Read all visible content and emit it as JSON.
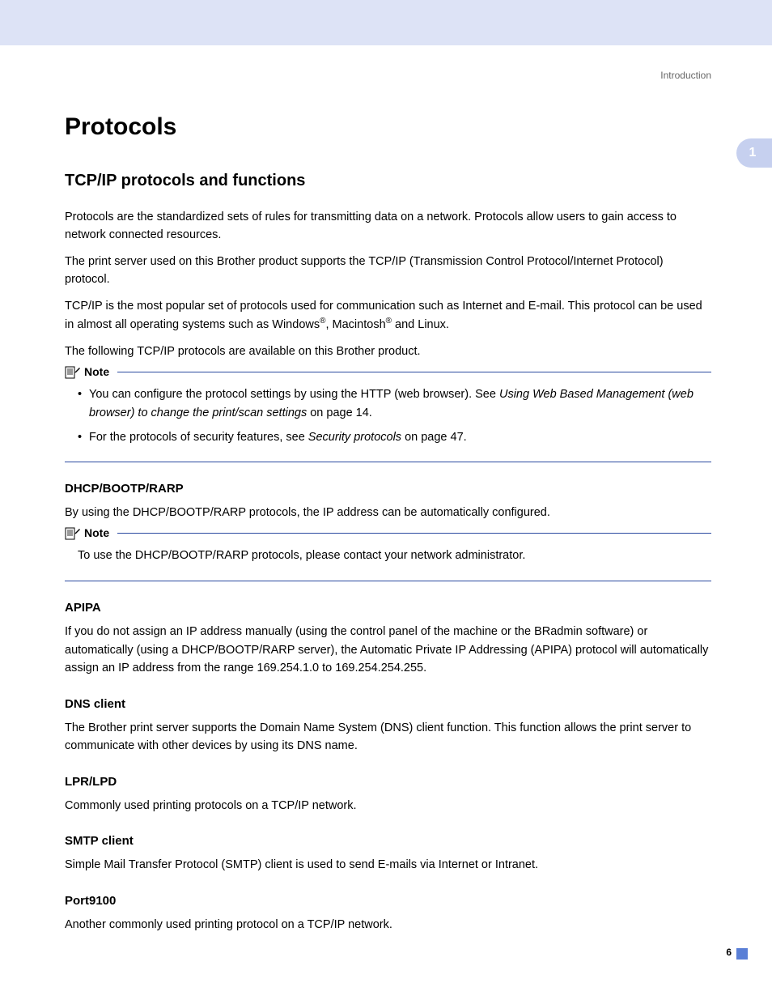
{
  "header": {
    "section_label": "Introduction"
  },
  "side_tab": "1",
  "title": "Protocols",
  "subtitle": "TCP/IP protocols and functions",
  "intro": {
    "p1": "Protocols are the standardized sets of rules for transmitting data on a network. Protocols allow users to gain access to network connected resources.",
    "p2": "The print server used on this Brother product supports the TCP/IP (Transmission Control Protocol/Internet Protocol) protocol.",
    "p3_a": "TCP/IP is the most popular set of protocols used for communication such as Internet and E-mail. This protocol can be used in almost all operating systems such as Windows",
    "p3_b": ", Macintosh",
    "p3_c": " and Linux.",
    "p4": "The following TCP/IP protocols are available on this Brother product."
  },
  "note1": {
    "label": "Note",
    "item1_a": "You can configure the protocol settings by using the HTTP (web browser). See ",
    "item1_link": "Using Web Based Management (web browser) to change the print/scan settings",
    "item1_b": " on page 14.",
    "item2_a": "For the protocols of security features, see ",
    "item2_link": "Security protocols",
    "item2_b": " on page 47."
  },
  "sections": {
    "dhcp": {
      "heading": "DHCP/BOOTP/RARP",
      "body": "By using the DHCP/BOOTP/RARP protocols, the IP address can be automatically configured."
    },
    "note2": {
      "label": "Note",
      "text": "To use the DHCP/BOOTP/RARP protocols, please contact your network administrator."
    },
    "apipa": {
      "heading": "APIPA",
      "body": "If you do not assign an IP address manually (using the control panel of the machine or the BRadmin software) or automatically (using a DHCP/BOOTP/RARP server), the Automatic Private IP Addressing (APIPA) protocol will automatically assign an IP address from the range 169.254.1.0 to 169.254.254.255."
    },
    "dns": {
      "heading": "DNS client",
      "body": "The Brother print server supports the Domain Name System (DNS) client function. This function allows the print server to communicate with other devices by using its DNS name."
    },
    "lpr": {
      "heading": "LPR/LPD",
      "body": "Commonly used printing protocols on a TCP/IP network."
    },
    "smtp": {
      "heading": "SMTP client",
      "body": "Simple Mail Transfer Protocol (SMTP) client is used to send E-mails via Internet or Intranet."
    },
    "port9100": {
      "heading": "Port9100",
      "body": "Another commonly used printing protocol on a TCP/IP network."
    }
  },
  "page_number": "6",
  "reg_mark": "®"
}
